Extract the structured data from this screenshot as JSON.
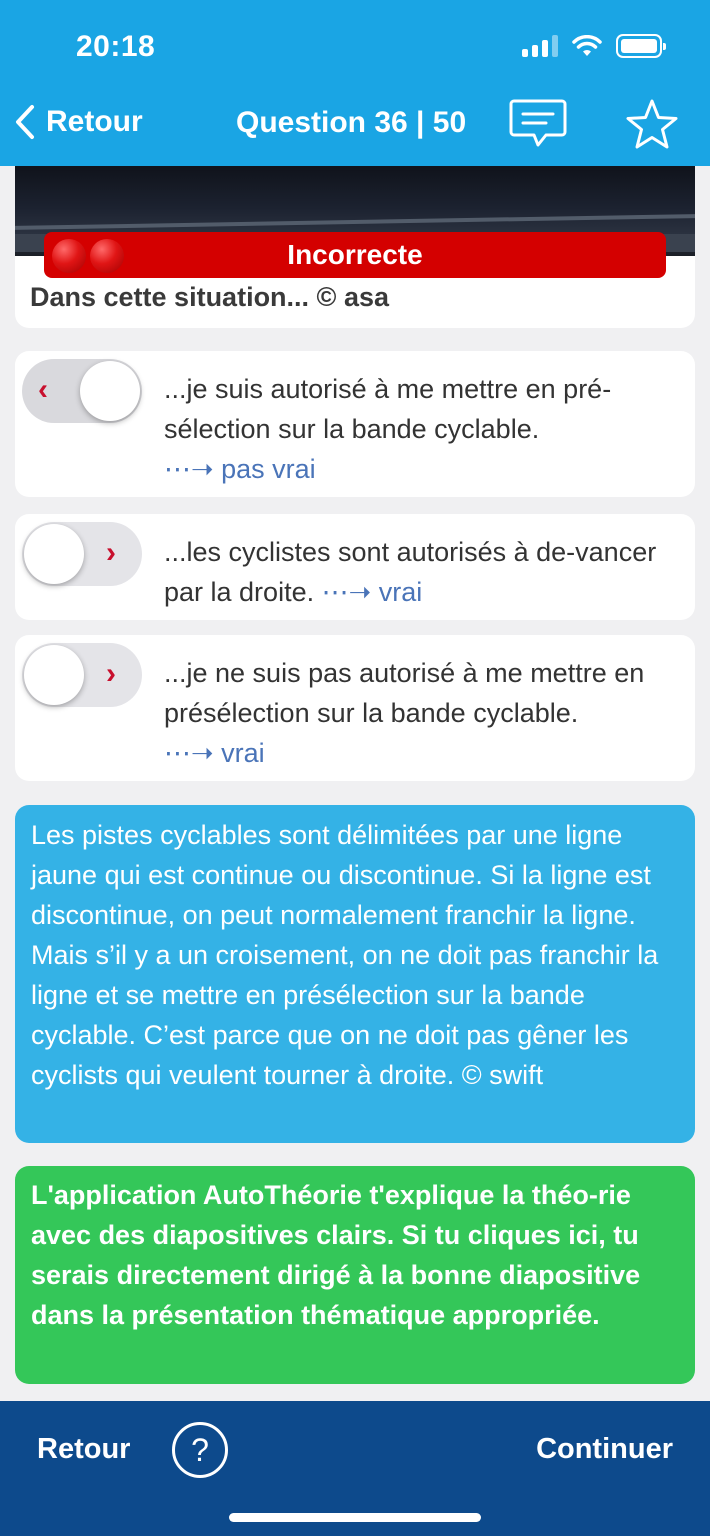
{
  "status": {
    "time": "20:18"
  },
  "nav": {
    "back_label": "Retour",
    "title": "Question 36 | 50",
    "chat_icon": "chat-icon",
    "favorite_icon": "star-icon"
  },
  "question": {
    "result_label": "Incorrecte",
    "text": "Dans cette situation... © asa"
  },
  "answers": [
    {
      "text": "...je suis autorisé à me mettre en pré-sélection sur la bande cyclable.",
      "verdict": "⋯➝ pas vrai",
      "toggle": "on",
      "chevron": "‹"
    },
    {
      "text": "...les cyclistes sont autorisés à de-vancer par la droite.",
      "verdict": "⋯➝ vrai",
      "toggle": "off",
      "chevron": "›"
    },
    {
      "text": "...je ne suis pas autorisé à me mettre en présélection sur la bande cyclable.",
      "verdict": "⋯➝ vrai",
      "toggle": "off",
      "chevron": "›"
    }
  ],
  "explanation": "Les pistes cyclables sont délimitées par une ligne jaune qui est continue ou discontinue. Si la ligne est discontinue, on peut normalement franchir la ligne. Mais s’il y a un croisement, on ne doit pas franchir la ligne et se mettre en présélection sur la bande cyclable. C’est parce que on ne doit pas gêner les cyclists qui veulent tourner à droite. © swift",
  "promo": "L'application AutoThéorie t'explique la théo-rie avec des diapositives clairs. Si tu cliques ici, tu serais directement dirigé à la bonne diapositive dans la présentation thématique appropriée.",
  "bottom": {
    "back_label": "Retour",
    "help_label": "?",
    "next_label": "Continuer"
  },
  "colors": {
    "header": "#1aa5e4",
    "incorrect": "#d40000",
    "explanation": "#34b2e6",
    "promo": "#34c759",
    "bottom_bar": "#0d4a8c",
    "verdict": "#4a74b8"
  }
}
